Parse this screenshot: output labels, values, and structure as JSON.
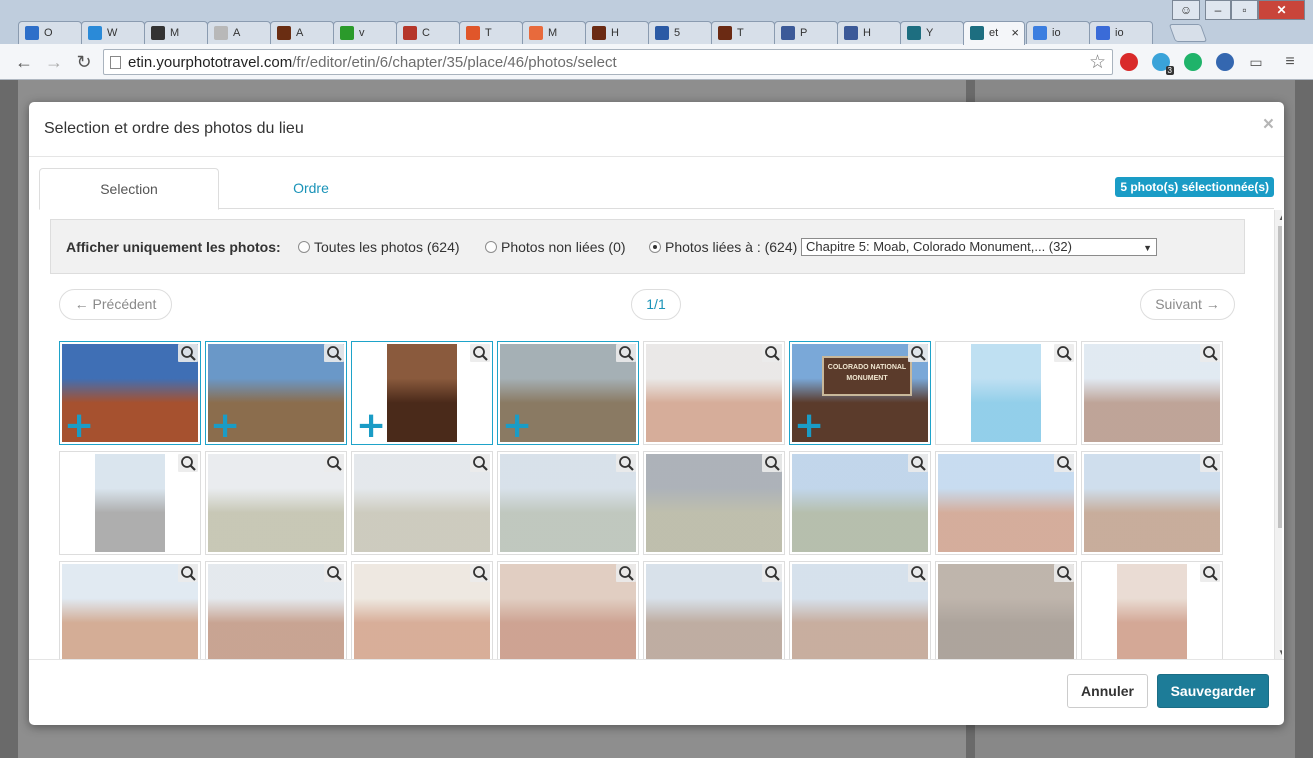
{
  "browser": {
    "tabs": [
      {
        "label": "O",
        "icon": "outlook-icon",
        "color": "#2e6fc9"
      },
      {
        "label": "W",
        "icon": "wunderlist-icon",
        "color": "#2a8ad8"
      },
      {
        "label": "M",
        "icon": "barcode-icon",
        "color": "#333333"
      },
      {
        "label": "A",
        "icon": "page-icon",
        "color": "#b8b8b8"
      },
      {
        "label": "A",
        "icon": "app-icon",
        "color": "#6a2d12"
      },
      {
        "label": "v",
        "icon": "plus-icon",
        "color": "#2b9a2b"
      },
      {
        "label": "C",
        "icon": "circle-icon",
        "color": "#b5362a"
      },
      {
        "label": "T",
        "icon": "s-icon",
        "color": "#e0562a"
      },
      {
        "label": "M",
        "icon": "cross-icon",
        "color": "#e86a3c"
      },
      {
        "label": "H",
        "icon": "star-icon",
        "color": "#6b2a13"
      },
      {
        "label": "5",
        "icon": "word-icon",
        "color": "#2b5aa5"
      },
      {
        "label": "T",
        "icon": "star-icon",
        "color": "#6b2a13"
      },
      {
        "label": "P",
        "icon": "facebook-icon",
        "color": "#3b5998"
      },
      {
        "label": "H",
        "icon": "facebook-icon",
        "color": "#3b5998"
      },
      {
        "label": "Y",
        "icon": "tag-icon",
        "color": "#1d6e80"
      },
      {
        "label": "et",
        "icon": "tag-icon",
        "color": "#1d6e80",
        "active": true
      },
      {
        "label": "io",
        "icon": "google-icon",
        "color": "#3b7ee0"
      },
      {
        "label": "io",
        "icon": "circle-icon",
        "color": "#3a6bd8"
      }
    ],
    "url_host": "etin.yourphototravel.com",
    "url_path": "/fr/editor/etin/6/chapter/35/place/46/photos/select",
    "extensions": [
      {
        "name": "adblock-icon",
        "color": "#d92a2a"
      },
      {
        "name": "ghost-icon",
        "color": "#3aa3d9",
        "badge": "3"
      },
      {
        "name": "grammarly-icon",
        "color": "#1fb36a"
      },
      {
        "name": "globe-icon",
        "color": "#3467b0"
      }
    ]
  },
  "modal": {
    "title": "Selection et ordre des photos du lieu",
    "close": "×",
    "tabs": {
      "selection": "Selection",
      "ordre": "Ordre"
    },
    "selected_badge": "5 photo(s) sélectionnée(s)",
    "filter": {
      "label": "Afficher uniquement les photos:",
      "options": [
        {
          "label": "Toutes les photos (624)",
          "checked": false
        },
        {
          "label": "Photos non liées (0)",
          "checked": false
        },
        {
          "label": "Photos liées à : (624)",
          "checked": true
        }
      ],
      "select_value": "Chapitre 5: Moab, Colorado Monument,... (32)"
    },
    "pager": {
      "prev": "← Précédent",
      "page": "1/1",
      "next": "Suivant →"
    },
    "photos": [
      {
        "selected": true,
        "sky": "#3f6fb5",
        "ground": "#a6512f",
        "portrait": false
      },
      {
        "selected": true,
        "sky": "#6a98c8",
        "ground": "#8b6d4d",
        "portrait": false
      },
      {
        "selected": true,
        "sky": "#8a5a3d",
        "ground": "#4a2a1a",
        "portrait": true
      },
      {
        "selected": true,
        "sky": "#a5b0b5",
        "ground": "#8a7a63",
        "portrait": false
      },
      {
        "selected": false,
        "sky": "#d9d6d4",
        "ground": "#b46a47",
        "portrait": false
      },
      {
        "selected": true,
        "sky": "#7aa8d8",
        "ground": "#5b3b2b",
        "portrait": false,
        "sign": "COLORADO NATIONAL MONUMENT"
      },
      {
        "selected": false,
        "sky": "#8bc6e8",
        "ground": "#3aa8d8",
        "portrait": true
      },
      {
        "selected": false,
        "sky": "#c9d8e8",
        "ground": "#8a5a44",
        "portrait": false
      },
      {
        "selected": false,
        "sky": "#bcd0e0",
        "ground": "#6b6b6b",
        "portrait": true
      },
      {
        "selected": false,
        "sky": "#d8dde2",
        "ground": "#9a9a7a",
        "portrait": false
      },
      {
        "selected": false,
        "sky": "#cfd6dc",
        "ground": "#a4a18a",
        "portrait": false
      },
      {
        "selected": false,
        "sky": "#b8c9d8",
        "ground": "#8d9a8a",
        "portrait": false
      },
      {
        "selected": false,
        "sky": "#6a7480",
        "ground": "#8a8a6a",
        "portrait": false
      },
      {
        "selected": false,
        "sky": "#8fb5da",
        "ground": "#7a8a6a",
        "portrait": false
      },
      {
        "selected": false,
        "sky": "#9ac0e3",
        "ground": "#b26a4a",
        "portrait": false
      },
      {
        "selected": false,
        "sky": "#a8c3de",
        "ground": "#9a6a4a",
        "portrait": false
      },
      {
        "selected": false,
        "sky": "#c8d8e8",
        "ground": "#b06a40",
        "portrait": false
      },
      {
        "selected": false,
        "sky": "#cfd7df",
        "ground": "#9c5a3a",
        "portrait": false
      },
      {
        "selected": false,
        "sky": "#e0d6c8",
        "ground": "#b86b45",
        "portrait": false
      },
      {
        "selected": false,
        "sky": "#c8a690",
        "ground": "#a5583a",
        "portrait": false
      },
      {
        "selected": false,
        "sky": "#b8c8d8",
        "ground": "#8a6a55",
        "portrait": false
      },
      {
        "selected": false,
        "sky": "#b5c9dd",
        "ground": "#9a6b50",
        "portrait": false
      },
      {
        "selected": false,
        "sky": "#8a7868",
        "ground": "#6a5a4c",
        "portrait": false
      },
      {
        "selected": false,
        "sky": "#d8c0b0",
        "ground": "#b06040",
        "portrait": true
      }
    ],
    "footer": {
      "cancel": "Annuler",
      "save": "Sauvegarder"
    }
  },
  "colors": {
    "accent": "#1a9cc6",
    "primary_button": "#1d7c98"
  }
}
